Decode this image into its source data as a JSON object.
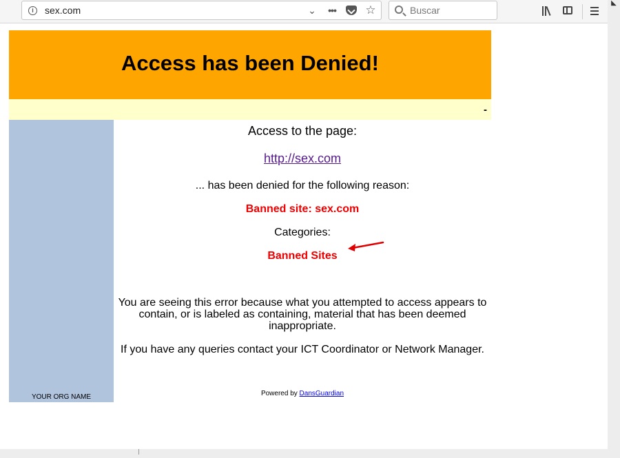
{
  "browser": {
    "url": "sex.com",
    "search_placeholder": "Buscar",
    "icons": [
      "info-icon",
      "chevron-down-icon",
      "more-icon",
      "pocket-icon",
      "star-icon",
      "search-icon",
      "library-icon",
      "sidebar-icon",
      "menu-icon"
    ]
  },
  "page": {
    "title": "Access has been Denied!",
    "subbar_text": "-",
    "org_name": "YOUR ORG NAME",
    "access_label": "Access to the page:",
    "blocked_url": "http://sex.com",
    "denied_text": "... has been denied for the following reason:",
    "reason": "Banned site: sex.com",
    "categories_label": "Categories:",
    "category": "Banned Sites",
    "explanation": "You are seeing this error because what you attempted to access appears to contain, or is labeled as containing, material that has been deemed inappropriate.",
    "contact": "If you have any queries contact your ICT Coordinator or Network Manager.",
    "powered_by": "Powered by",
    "powered_link": "DansGuardian"
  },
  "colors": {
    "banner": "#ffa500",
    "subbar": "#ffffcc",
    "sidebar": "#b0c4de",
    "alert_text": "#ee0000",
    "annotation_arrow": "#e00000"
  }
}
